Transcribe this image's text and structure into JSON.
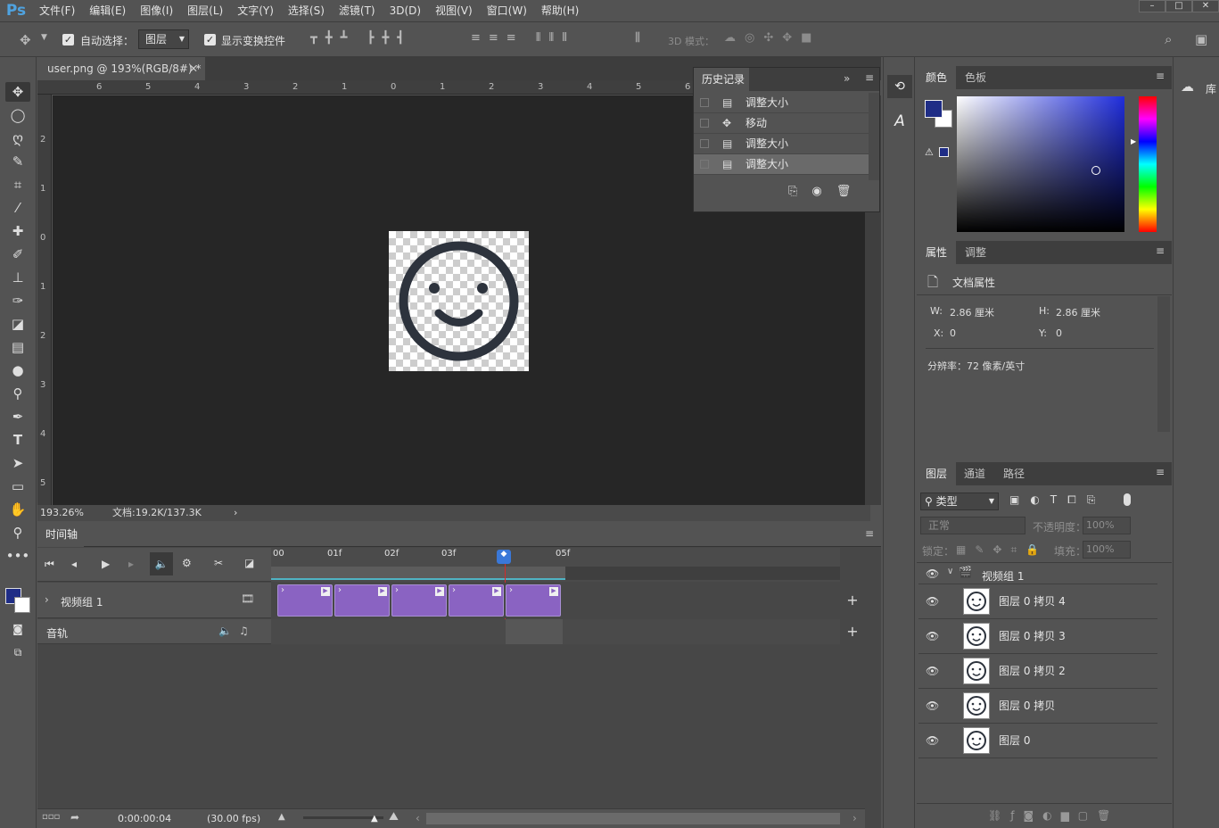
{
  "app": {
    "logo": "Ps",
    "win_min": "–",
    "win_max": "□",
    "win_close": "✕"
  },
  "menu": [
    "文件(F)",
    "编辑(E)",
    "图像(I)",
    "图层(L)",
    "文字(Y)",
    "选择(S)",
    "滤镜(T)",
    "3D(D)",
    "视图(V)",
    "窗口(W)",
    "帮助(H)"
  ],
  "options": {
    "auto_select_label": "自动选择：",
    "auto_select_value": "图层",
    "show_transform_label": "显示变换控件",
    "mode_3d_label": "3D 模式："
  },
  "document": {
    "tab_title": "user.png @ 193%(RGB/8#) *",
    "zoom": "193.26%",
    "doc_info": "文档:19.2K/137.3K"
  },
  "ruler_top": [
    "6",
    "5",
    "4",
    "3",
    "2",
    "1",
    "0",
    "1",
    "2",
    "3",
    "4",
    "5",
    "6"
  ],
  "ruler_left": [
    "2",
    "1",
    "0",
    "1",
    "2",
    "3",
    "4",
    "5"
  ],
  "history": {
    "title": "历史记录",
    "items": [
      {
        "label": "调整大小",
        "icon": "doc"
      },
      {
        "label": "移动",
        "icon": "move"
      },
      {
        "label": "调整大小",
        "icon": "doc"
      },
      {
        "label": "调整大小",
        "icon": "doc"
      }
    ]
  },
  "timeline": {
    "title": "时间轴",
    "ticks": [
      "00",
      "01f",
      "02f",
      "03f",
      "05f"
    ],
    "video_group": "视频组 1",
    "audio_track": "音轨",
    "timecode": "0:00:00:04",
    "fps": "(30.00 fps)"
  },
  "color_panel": {
    "tabs": [
      "颜色",
      "色板"
    ],
    "fg_color": "#1f2d86",
    "bg_color": "#ffffff"
  },
  "properties": {
    "tabs": [
      "属性",
      "调整"
    ],
    "doc_props": "文档属性",
    "w_label": "W:",
    "w_value": "2.86 厘米",
    "h_label": "H:",
    "h_value": "2.86 厘米",
    "x_label": "X:",
    "x_value": "0",
    "y_label": "Y:",
    "y_value": "0",
    "resolution": "分辨率：72 像素/英寸"
  },
  "layers": {
    "tabs": [
      "图层",
      "通道",
      "路径"
    ],
    "filter_kind": "类型",
    "blend_mode": "正常",
    "opacity_label": "不透明度：",
    "opacity_value": "100%",
    "lock_label": "锁定：",
    "fill_label": "填充：",
    "fill_value": "100%",
    "group_name": "视频组 1",
    "items": [
      "图层 0 拷贝 4",
      "图层 0 拷贝 3",
      "图层 0 拷贝 2",
      "图层 0 拷贝",
      "图层 0"
    ]
  },
  "library": {
    "label": "库"
  }
}
